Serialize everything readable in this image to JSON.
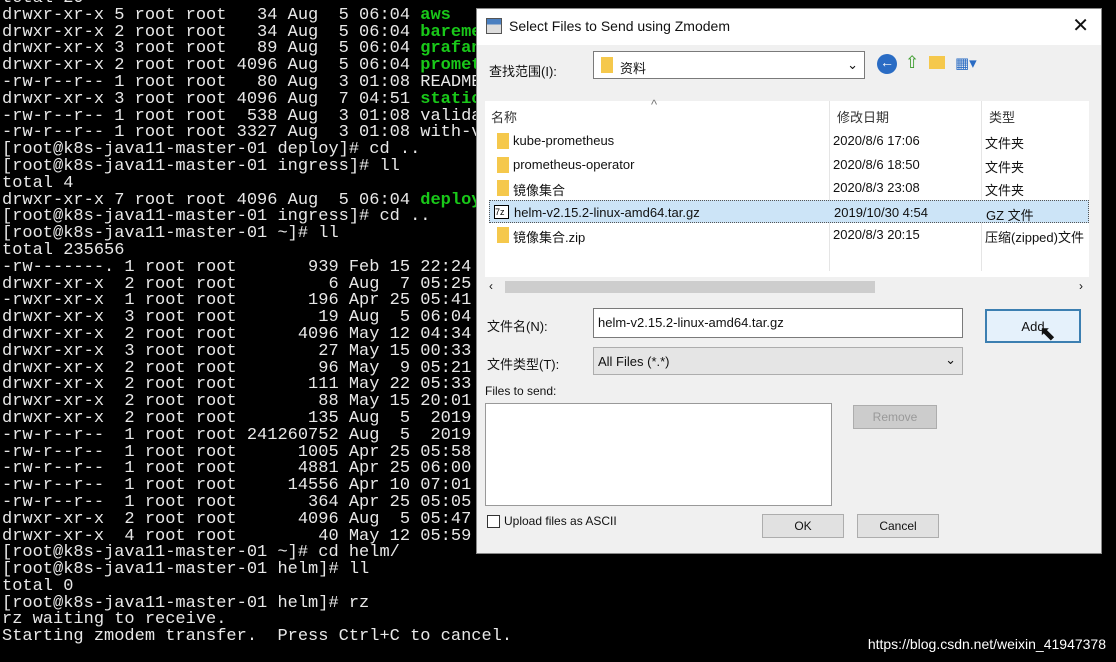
{
  "terminal": {
    "lines": [
      {
        "t": "total 20"
      },
      {
        "t": "drwxr-xr-x 5 root root   34 Aug  5 06:04 ",
        "n": "aws"
      },
      {
        "t": "drwxr-xr-x 2 root root   34 Aug  5 06:04 ",
        "n": "bareme"
      },
      {
        "t": "drwxr-xr-x 3 root root   89 Aug  5 06:04 ",
        "n": "grafan"
      },
      {
        "t": "drwxr-xr-x 2 root root 4096 Aug  5 06:04 ",
        "n": "promet"
      },
      {
        "t": "-rw-r--r-- 1 root root   80 Aug  3 01:08 README"
      },
      {
        "t": "drwxr-xr-x 3 root root 4096 Aug  7 04:51 ",
        "n": "static"
      },
      {
        "t": "-rw-r--r-- 1 root root  538 Aug  3 01:08 valida"
      },
      {
        "t": "-rw-r--r-- 1 root root 3327 Aug  3 01:08 with-v"
      },
      {
        "t": "[root@k8s-java11-master-01 deploy]# cd .."
      },
      {
        "t": "[root@k8s-java11-master-01 ingress]# ll"
      },
      {
        "t": "total 4"
      },
      {
        "t": "drwxr-xr-x 7 root root 4096 Aug  5 06:04 ",
        "n": "deploy"
      },
      {
        "t": "[root@k8s-java11-master-01 ingress]# cd .."
      },
      {
        "t": "[root@k8s-java11-master-01 ~]# ll"
      },
      {
        "t": "total 235656"
      },
      {
        "t": "-rw-------. 1 root root       939 Feb 15 22:24"
      },
      {
        "t": "drwxr-xr-x  2 root root         6 Aug  7 05:25"
      },
      {
        "t": "-rwxr-xr-x  1 root root       196 Apr 25 05:41"
      },
      {
        "t": "drwxr-xr-x  3 root root        19 Aug  5 06:04"
      },
      {
        "t": "drwxr-xr-x  2 root root      4096 May 12 04:34"
      },
      {
        "t": "drwxr-xr-x  3 root root        27 May 15 00:33"
      },
      {
        "t": "drwxr-xr-x  2 root root        96 May  9 05:21"
      },
      {
        "t": "drwxr-xr-x  2 root root       111 May 22 05:33"
      },
      {
        "t": "drwxr-xr-x  2 root root        88 May 15 20:01"
      },
      {
        "t": "drwxr-xr-x  2 root root       135 Aug  5  2019"
      },
      {
        "t": "-rw-r--r--  1 root root 241260752 Aug  5  2019"
      },
      {
        "t": "-rw-r--r--  1 root root      1005 Apr 25 05:58"
      },
      {
        "t": "-rw-r--r--  1 root root      4881 Apr 25 06:00"
      },
      {
        "t": "-rw-r--r--  1 root root     14556 Apr 10 07:01"
      },
      {
        "t": "-rw-r--r--  1 root root       364 Apr 25 05:05"
      },
      {
        "t": "drwxr-xr-x  2 root root      4096 Aug  5 05:47"
      },
      {
        "t": "drwxr-xr-x  4 root root        40 May 12 05:59"
      },
      {
        "t": "[root@k8s-java11-master-01 ~]# cd helm/"
      },
      {
        "t": "[root@k8s-java11-master-01 helm]# ll"
      },
      {
        "t": "total 0"
      },
      {
        "t": "[root@k8s-java11-master-01 helm]# rz"
      },
      {
        "t": "rz waiting to receive."
      },
      {
        "t": "Starting zmodem transfer.  Press Ctrl+C to cancel."
      }
    ]
  },
  "dialog": {
    "title": "Select Files to Send using Zmodem",
    "look_in_label": "查找范围(I):",
    "look_in_value": "资料",
    "columns": [
      "名称",
      "修改日期",
      "类型"
    ],
    "files": [
      {
        "name": "kube-prometheus",
        "date": "2020/8/6 17:06",
        "type": "文件夹"
      },
      {
        "name": "prometheus-operator",
        "date": "2020/8/6 18:50",
        "type": "文件夹"
      },
      {
        "name": "镜像集合",
        "date": "2020/8/3 23:08",
        "type": "文件夹"
      },
      {
        "name": "helm-v2.15.2-linux-amd64.tar.gz",
        "date": "2019/10/30 4:54",
        "type": "GZ 文件"
      },
      {
        "name": "镜像集合.zip",
        "date": "2020/8/3 20:15",
        "type": "压缩(zipped)文件"
      }
    ],
    "filename_label": "文件名(N):",
    "filename_value": "helm-v2.15.2-linux-amd64.tar.gz",
    "filetype_label": "文件类型(T):",
    "filetype_value": "All Files (*.*)",
    "add": "Add",
    "files_to_send": "Files to send:",
    "remove": "Remove",
    "ascii": "Upload files as ASCII",
    "ok": "OK",
    "cancel": "Cancel"
  },
  "watermark": "https://blog.csdn.net/weixin_41947378"
}
